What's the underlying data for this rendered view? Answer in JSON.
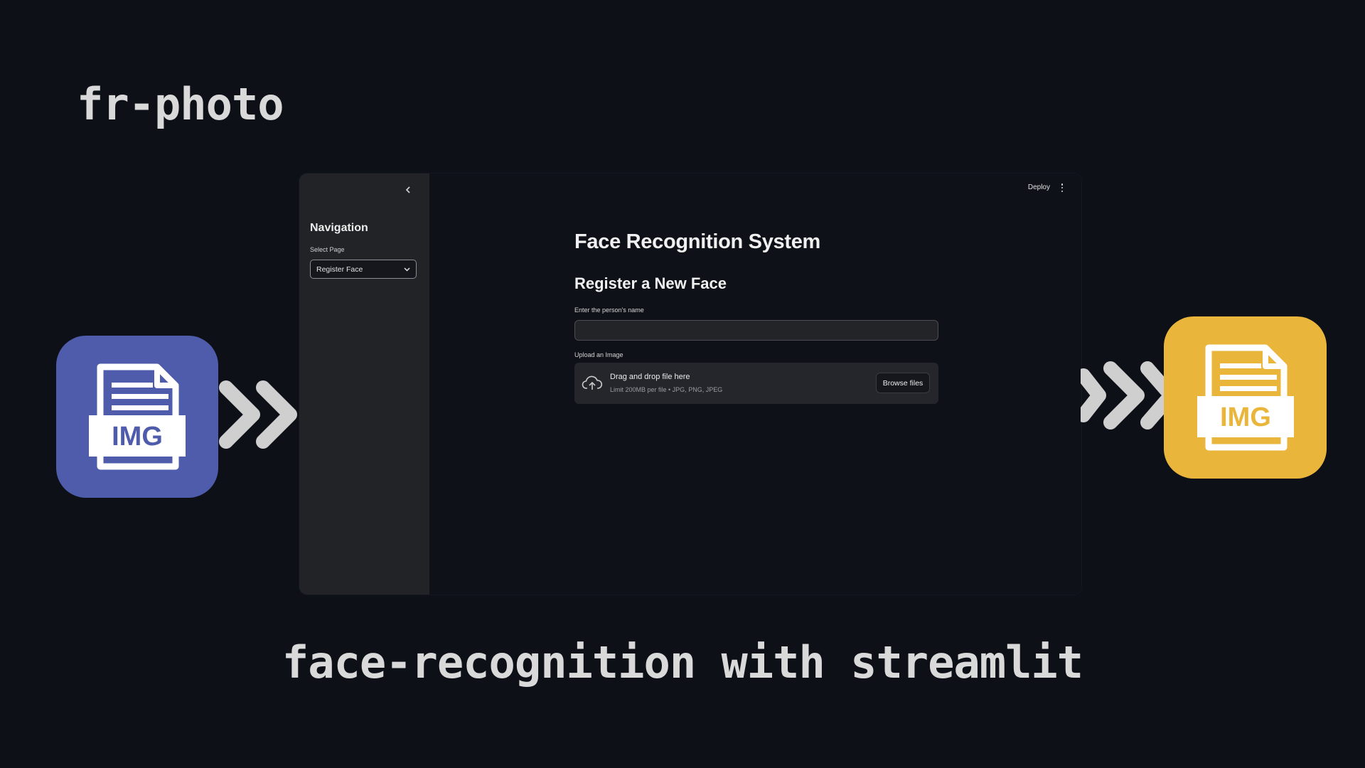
{
  "banner": {
    "heading": "fr-photo",
    "caption": "face-recognition with streamlit"
  },
  "tiles": {
    "left": {
      "label": "IMG",
      "color": "#4f5cac",
      "icon": "file-image-icon"
    },
    "right": {
      "label": "IMG",
      "color": "#e9b53b",
      "icon": "file-image-icon"
    },
    "arrow_color": "#cfcfcf"
  },
  "sidebar": {
    "title": "Navigation",
    "select_label": "Select Page",
    "select_value": "Register Face",
    "collapse_icon": "chevron-left-icon"
  },
  "toolbar": {
    "deploy_label": "Deploy",
    "menu_icon": "more-vertical-icon"
  },
  "main": {
    "title": "Face Recognition System",
    "subtitle": "Register a New Face",
    "name_label": "Enter the person's name",
    "name_value": "",
    "upload_label": "Upload an Image",
    "dropzone_title": "Drag and drop file here",
    "dropzone_hint": "Limit 200MB per file • JPG, PNG, JPEG",
    "browse_label": "Browse files"
  }
}
